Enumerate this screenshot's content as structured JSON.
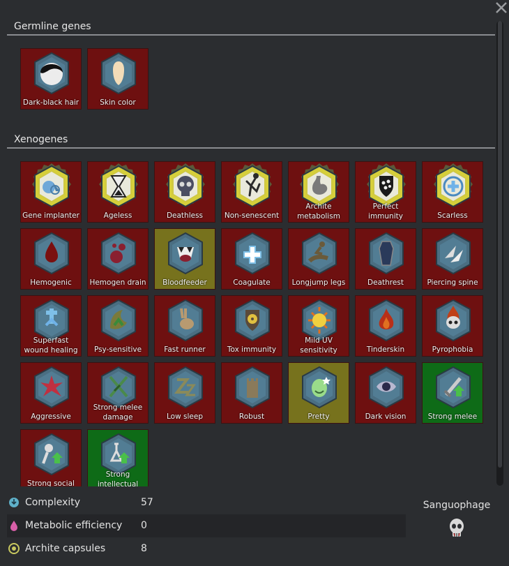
{
  "sections": {
    "germline": "Germline genes",
    "xenogenes": "Xenogenes"
  },
  "germline_genes": [
    {
      "label": "Dark-black hair",
      "color": "red",
      "icon": "hair-icon"
    },
    {
      "label": "Skin color",
      "color": "red",
      "icon": "skin-color-icon"
    }
  ],
  "xenogenes": [
    {
      "label": "Gene implanter",
      "color": "red",
      "icon": "gene-implanter-icon",
      "archite": true
    },
    {
      "label": "Ageless",
      "color": "red",
      "icon": "hourglass-icon",
      "archite": true
    },
    {
      "label": "Deathless",
      "color": "red",
      "icon": "skull-icon",
      "archite": true
    },
    {
      "label": "Non-senescent",
      "color": "red",
      "icon": "leaping-figure-icon",
      "archite": true
    },
    {
      "label": "Archite metabolism",
      "color": "red",
      "icon": "stomach-icon",
      "archite": true
    },
    {
      "label": "Perfect immunity",
      "color": "red",
      "icon": "shield-icon",
      "archite": true
    },
    {
      "label": "Scarless",
      "color": "red",
      "icon": "regen-cross-icon",
      "archite": true
    },
    {
      "label": "Hemogenic",
      "color": "red",
      "icon": "blood-drop-icon"
    },
    {
      "label": "Hemogen drain",
      "color": "red",
      "icon": "blood-drain-icon"
    },
    {
      "label": "Bloodfeeder",
      "color": "yellow",
      "icon": "fangs-icon"
    },
    {
      "label": "Coagulate",
      "color": "red",
      "icon": "hand-cross-icon"
    },
    {
      "label": "Longjump legs",
      "color": "red",
      "icon": "jumping-figure-icon"
    },
    {
      "label": "Deathrest",
      "color": "red",
      "icon": "coffin-icon"
    },
    {
      "label": "Piercing spine",
      "color": "red",
      "icon": "spines-icon"
    },
    {
      "label": "Superfast wound healing",
      "color": "red",
      "icon": "wound-heal-icon"
    },
    {
      "label": "Psy-sensitive",
      "color": "red",
      "icon": "psy-icon"
    },
    {
      "label": "Fast runner",
      "color": "red",
      "icon": "rabbit-icon"
    },
    {
      "label": "Tox immunity",
      "color": "red",
      "icon": "radiation-shield-icon"
    },
    {
      "label": "Mild UV sensitivity",
      "color": "red",
      "icon": "sun-icon"
    },
    {
      "label": "Tinderskin",
      "color": "red",
      "icon": "flame-icon"
    },
    {
      "label": "Pyrophobia",
      "color": "red",
      "icon": "burning-skull-icon"
    },
    {
      "label": "Aggressive",
      "color": "red",
      "icon": "burst-icon"
    },
    {
      "label": "Strong melee damage",
      "color": "red",
      "icon": "crossed-swords-icon"
    },
    {
      "label": "Low sleep",
      "color": "red",
      "icon": "sleep-zz-icon"
    },
    {
      "label": "Robust",
      "color": "red",
      "icon": "tower-icon"
    },
    {
      "label": "Pretty",
      "color": "yellow",
      "icon": "pretty-face-icon"
    },
    {
      "label": "Dark vision",
      "color": "red",
      "icon": "eye-icon"
    },
    {
      "label": "Strong melee",
      "color": "green",
      "icon": "sword-up-icon"
    },
    {
      "label": "Strong social",
      "color": "red",
      "icon": "microphone-up-icon"
    },
    {
      "label": "Strong intellectual",
      "color": "green",
      "icon": "flask-up-icon"
    }
  ],
  "stats": [
    {
      "label": "Complexity",
      "value": "57",
      "icon": "complexity-icon",
      "color": "#5fb0c8"
    },
    {
      "label": "Metabolic efficiency",
      "value": "0",
      "icon": "metabolism-icon",
      "color": "#d85fa8"
    },
    {
      "label": "Archite capsules",
      "value": "8",
      "icon": "archite-icon",
      "color": "#c8c85f"
    }
  ],
  "xenotype": {
    "name": "Sanguophage",
    "icon": "sanguophage-skull-icon"
  },
  "colors": {
    "red": "#6e1010",
    "yellow": "#77721d",
    "green": "#0e6b17",
    "hex_normal": "#4a6e82",
    "hex_archite": "#d6cf3a"
  }
}
